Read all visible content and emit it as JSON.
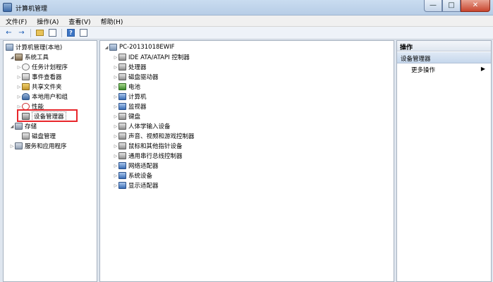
{
  "window": {
    "title": "计算机管理",
    "min_label": "—",
    "max_label": "□",
    "close_label": "✕"
  },
  "menu": [
    "文件(F)",
    "操作(A)",
    "查看(V)",
    "帮助(H)"
  ],
  "toolbar": {
    "back_icon": "←",
    "forward_icon": "→"
  },
  "left_tree": {
    "root": "计算机管理(本地)",
    "system_tools": "系统工具",
    "task_scheduler": "任务计划程序",
    "event_viewer": "事件查看器",
    "shared_folders": "共享文件夹",
    "local_users": "本地用户和组",
    "performance": "性能",
    "device_manager": "设备管理器",
    "storage": "存储",
    "disk_management": "磁盘管理",
    "services": "服务和应用程序"
  },
  "center_tree": {
    "computer_name": "PC-20131018EWIF",
    "devices": [
      "IDE ATA/ATAPI 控制器",
      "处理器",
      "磁盘驱动器",
      "电池",
      "计算机",
      "监视器",
      "键盘",
      "人体学输入设备",
      "声音、视频和游戏控制器",
      "鼠标和其他指针设备",
      "通用串行总线控制器",
      "网络适配器",
      "系统设备",
      "显示适配器"
    ]
  },
  "actions": {
    "header": "操作",
    "section": "设备管理器",
    "more": "更多操作",
    "more_arrow": "▶"
  }
}
